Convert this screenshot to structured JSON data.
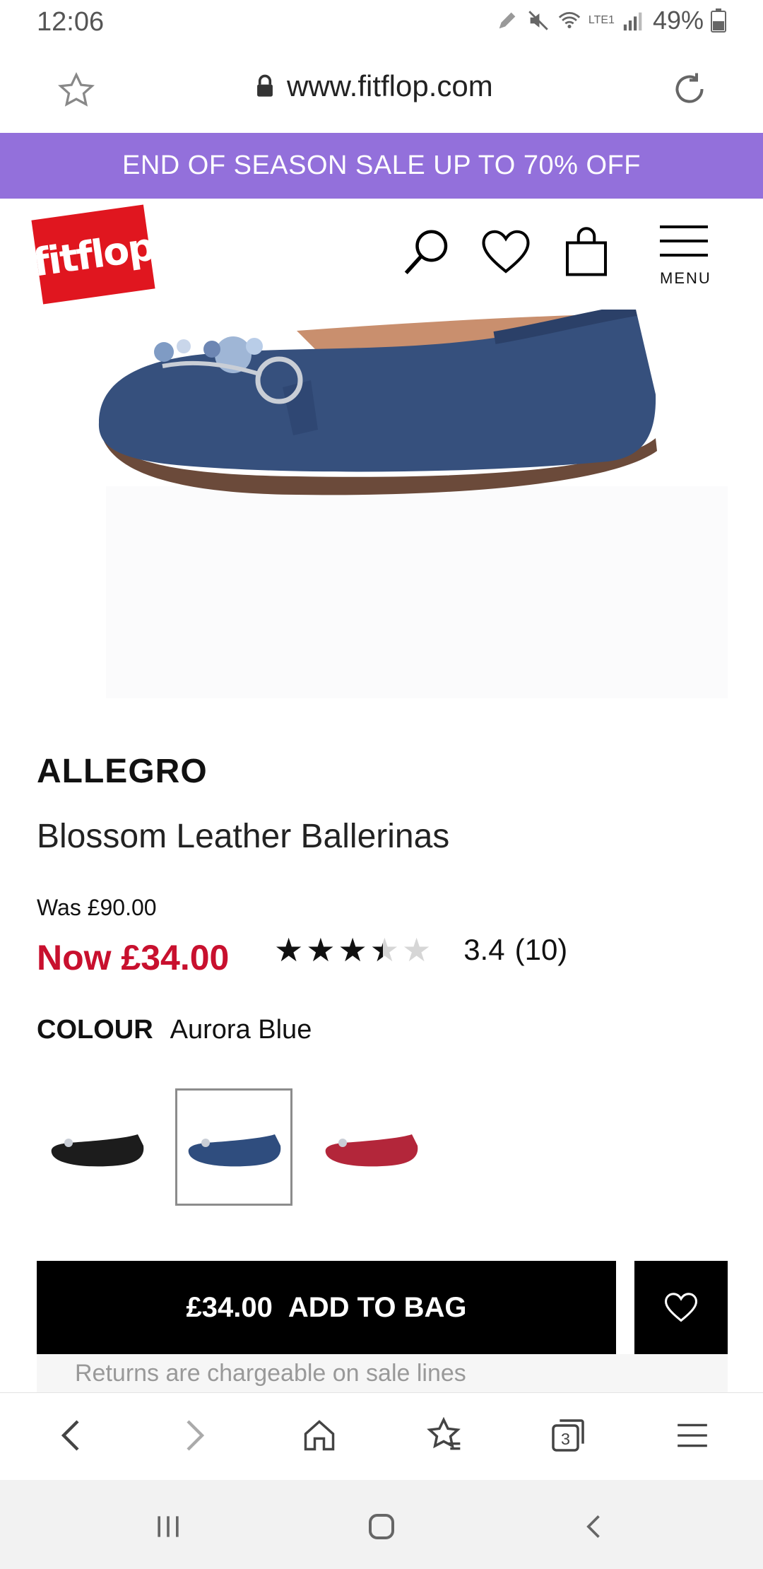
{
  "status_bar": {
    "time": "12:06",
    "battery": "49%",
    "network": "LTE1"
  },
  "browser": {
    "url": "www.fitflop.com",
    "tabs_count": "3"
  },
  "promo": {
    "text": "END OF SEASON SALE UP TO 70% OFF",
    "color": "#9370DB"
  },
  "header": {
    "logo_text": "fitflop",
    "menu_label": "MENU",
    "logo_color": "#E0161F"
  },
  "product": {
    "brand": "ALLEGRO",
    "name": "Blossom Leather Ballerinas",
    "was_price": "Was £90.00",
    "now_price": "Now £34.00",
    "rating": {
      "value": 3.4,
      "max": 5,
      "score_text": "3.4",
      "count_text": "(10)"
    },
    "colour_label": "COLOUR",
    "colour_value": "Aurora Blue",
    "swatches": [
      {
        "color": "#1c1c1c",
        "selected": false
      },
      {
        "color": "#2f4d7e",
        "selected": true
      },
      {
        "color": "#b3263a",
        "selected": false
      }
    ],
    "shoe_color": "#36507d"
  },
  "cta": {
    "price": "£34.00",
    "label": "ADD TO BAG"
  },
  "returns_note": "Returns are chargeable on sale lines"
}
